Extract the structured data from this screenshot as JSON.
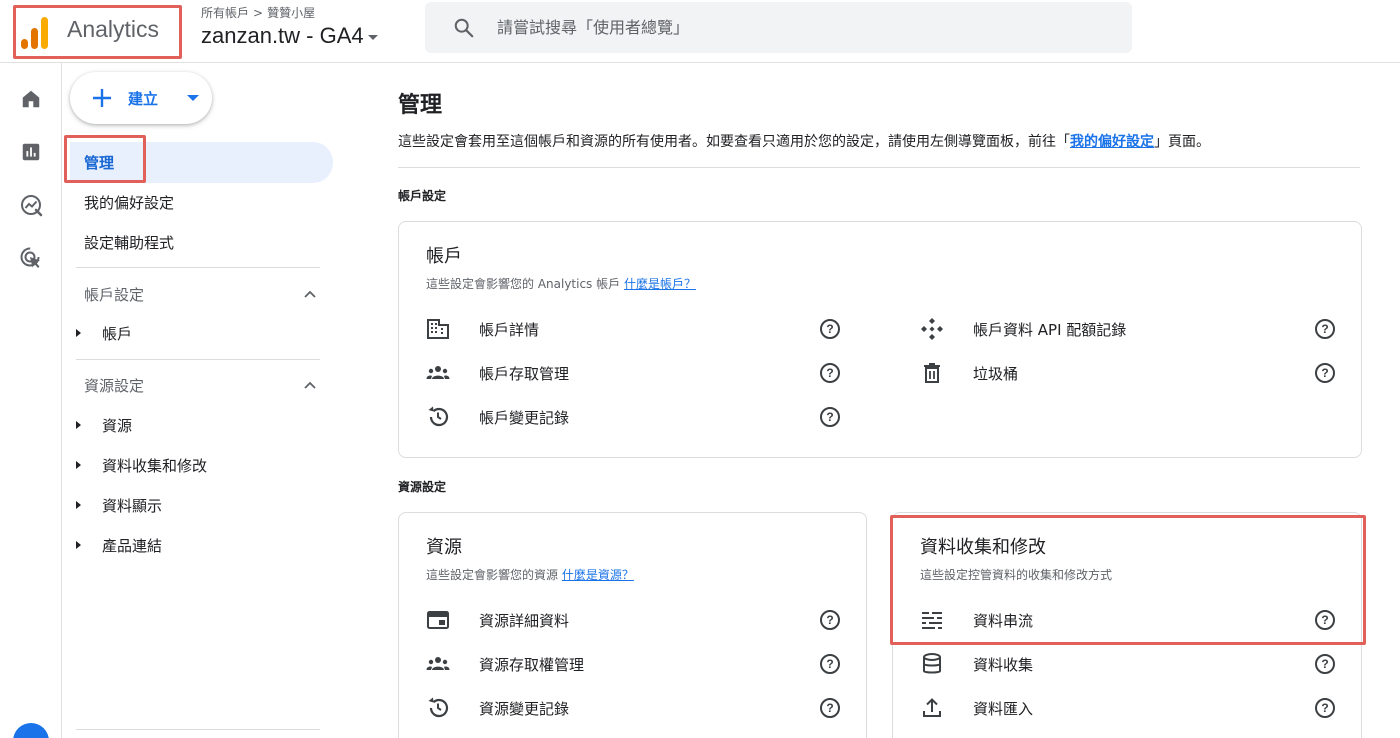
{
  "topbar": {
    "brand": "Analytics",
    "breadcrumb": {
      "account": "所有帳戶",
      "separator": ">",
      "property_group": "贊贊小屋"
    },
    "property_name": "zanzan.tw - GA4",
    "search_placeholder": "請嘗試搜尋「使用者總覽」"
  },
  "rail": {
    "items": [
      {
        "icon": "home-icon"
      },
      {
        "icon": "reports-icon"
      },
      {
        "icon": "explore-icon"
      },
      {
        "icon": "advertising-icon"
      }
    ]
  },
  "nav": {
    "create_label": "建立",
    "items": [
      {
        "label": "管理",
        "active": true
      },
      {
        "label": "我的偏好設定"
      },
      {
        "label": "設定輔助程式"
      }
    ],
    "account_section": {
      "label": "帳戶設定",
      "children": [
        "帳戶"
      ]
    },
    "property_section": {
      "label": "資源設定",
      "children": [
        "資源",
        "資料收集和修改",
        "資料顯示",
        "產品連結"
      ]
    }
  },
  "main": {
    "title": "管理",
    "description_prefix": "這些設定會套用至這個帳戶和資源的所有使用者。如要查看只適用於您的設定，請使用左側導覽面板，前往「",
    "description_link": "我的偏好設定",
    "description_suffix": "」頁面。",
    "account_section_label": "帳戶設定",
    "property_section_label": "資源設定",
    "account_card": {
      "title": "帳戶",
      "desc_prefix": "這些設定會影響您的 Analytics 帳戶 ",
      "desc_link": "什麼是帳戶？",
      "left_rows": [
        {
          "label": "帳戶詳情",
          "icon": "building-icon"
        },
        {
          "label": "帳戶存取管理",
          "icon": "people-icon"
        },
        {
          "label": "帳戶變更記錄",
          "icon": "history-icon"
        }
      ],
      "right_rows": [
        {
          "label": "帳戶資料 API 配額記錄",
          "icon": "api-icon"
        },
        {
          "label": "垃圾桶",
          "icon": "trash-icon"
        }
      ]
    },
    "property_card": {
      "title": "資源",
      "desc_prefix": "這些設定會影響您的資源 ",
      "desc_link": "什麼是資源？",
      "rows": [
        {
          "label": "資源詳細資料",
          "icon": "property-details-icon"
        },
        {
          "label": "資源存取權管理",
          "icon": "people-icon"
        },
        {
          "label": "資源變更記錄",
          "icon": "history-icon"
        }
      ]
    },
    "data_card": {
      "title": "資料收集和修改",
      "desc": "這些設定控管資料的收集和修改方式",
      "rows": [
        {
          "label": "資料串流",
          "icon": "data-streams-icon"
        },
        {
          "label": "資料收集",
          "icon": "database-icon"
        },
        {
          "label": "資料匯入",
          "icon": "upload-icon"
        }
      ]
    },
    "help_glyph": "?"
  },
  "colors": {
    "accent": "#1a73e8",
    "highlight": "#e2605a",
    "active_bg": "#e8f0fe"
  }
}
